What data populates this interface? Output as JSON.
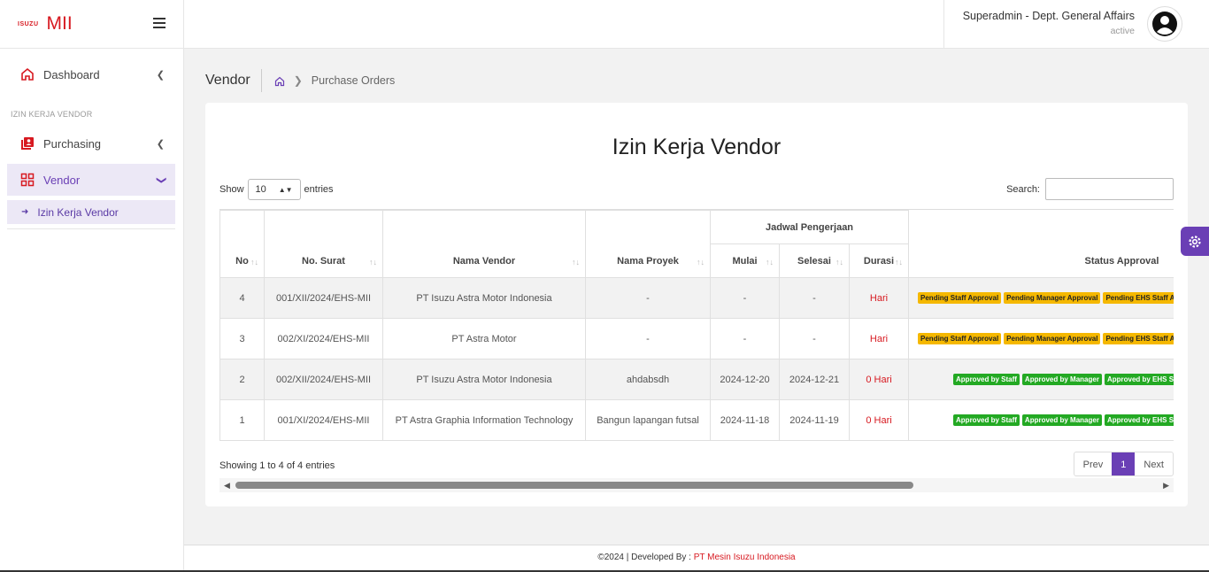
{
  "brand": {
    "logo_text": "ISUZU",
    "app_name": "MII"
  },
  "sidebar": {
    "dashboard": "Dashboard",
    "section_label": "IZIN KERJA VENDOR",
    "purchasing": "Purchasing",
    "vendor": "Vendor",
    "sub_item": "Izin Kerja Vendor"
  },
  "user": {
    "name": "Superadmin - Dept. General Affairs",
    "status": "active"
  },
  "breadcrumb": {
    "title": "Vendor",
    "current": "Purchase Orders"
  },
  "card": {
    "title": "Izin Kerja Vendor"
  },
  "controls": {
    "show_label": "Show",
    "entries_value": "10",
    "entries_label": "entries",
    "search_label": "Search:"
  },
  "table": {
    "headers": {
      "no": "No",
      "no_surat": "No. Surat",
      "nama_vendor": "Nama Vendor",
      "nama_proyek": "Nama Proyek",
      "group": "Jadwal Pengerjaan",
      "mulai": "Mulai",
      "selesai": "Selesai",
      "durasi": "Durasi",
      "status": "Status Approval"
    },
    "rows": [
      {
        "no": "4",
        "no_surat": "001/XII/2024/EHS-MII",
        "vendor": "PT Isuzu Astra Motor Indonesia",
        "proyek": "-",
        "mulai": "-",
        "selesai": "-",
        "durasi": "Hari",
        "b1": "Pending Staff Approval",
        "b2": "Pending Manager Approval",
        "b3": "Pending EHS Staff Approval"
      },
      {
        "no": "3",
        "no_surat": "002/XI/2024/EHS-MII",
        "vendor": "PT Astra Motor",
        "proyek": "-",
        "mulai": "-",
        "selesai": "-",
        "durasi": "Hari",
        "b1": "Pending Staff Approval",
        "b2": "Pending Manager Approval",
        "b3": "Pending EHS Staff Approval"
      },
      {
        "no": "2",
        "no_surat": "002/XII/2024/EHS-MII",
        "vendor": "PT Isuzu Astra Motor Indonesia",
        "proyek": "ahdabsdh",
        "mulai": "2024-12-20",
        "selesai": "2024-12-21",
        "durasi": "0 Hari",
        "b1": "Approved by Staff",
        "b2": "Approved by Manager",
        "b3": "Approved by EHS Staff"
      },
      {
        "no": "1",
        "no_surat": "001/XI/2024/EHS-MII",
        "vendor": "PT Astra Graphia Information Technology",
        "proyek": "Bangun lapangan futsal",
        "mulai": "2024-11-18",
        "selesai": "2024-11-19",
        "durasi": "0 Hari",
        "b1": "Approved by Staff",
        "b2": "Approved by Manager",
        "b3": "Approved by EHS Staff"
      }
    ]
  },
  "footer_info": "Showing 1 to 4 of 4 entries",
  "pager": {
    "prev": "Prev",
    "page": "1",
    "next": "Next"
  },
  "footer": {
    "text": "©2024 | Developed By : ",
    "company": "PT Mesin Isuzu Indonesia"
  },
  "colors": {
    "accent": "#6a3fb5",
    "brand": "#d71920",
    "pending": "#f5b800",
    "approved": "#23a923"
  }
}
